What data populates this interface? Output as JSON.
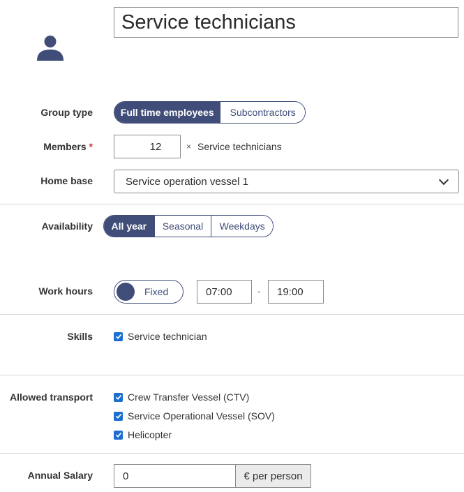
{
  "group": {
    "name": "Service technicians"
  },
  "fields": {
    "group_type": {
      "label": "Group type",
      "options": [
        "Full time employees",
        "Subcontractors"
      ],
      "selected": "Full time employees"
    },
    "members": {
      "label": "Members",
      "required_mark": "*",
      "value": "12",
      "multiplier": "×",
      "suffix": "Service technicians"
    },
    "home_base": {
      "label": "Home base",
      "selected": "Service operation vessel 1"
    },
    "availability": {
      "label": "Availability",
      "options": [
        "All year",
        "Seasonal",
        "Weekdays"
      ],
      "selected": "All year"
    },
    "work_hours": {
      "label": "Work hours",
      "toggle_label": "Fixed",
      "start": "07:00",
      "separator": "-",
      "end": "19:00"
    },
    "skills": {
      "label": "Skills",
      "items": [
        {
          "label": "Service technician",
          "checked": true
        }
      ]
    },
    "allowed_transport": {
      "label": "Allowed transport",
      "items": [
        {
          "label": "Crew Transfer Vessel (CTV)",
          "checked": true
        },
        {
          "label": "Service Operational Vessel (SOV)",
          "checked": true
        },
        {
          "label": "Helicopter",
          "checked": true
        }
      ]
    },
    "annual_salary": {
      "label": "Annual Salary",
      "value": "0",
      "unit": "€ per person"
    }
  },
  "colors": {
    "accent": "#3f4d78",
    "checkbox": "#1b6fd1",
    "required": "#d0343c"
  },
  "icons": {
    "avatar": "user-icon",
    "select": "chevron-down-icon",
    "checkbox": "check-icon"
  }
}
